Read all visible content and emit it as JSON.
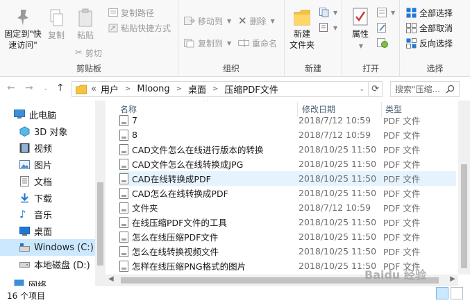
{
  "ribbon": {
    "clipboard": {
      "pin_label_line1": "固定到\"快",
      "pin_label_line2": "速访问\"",
      "copy_label": "复制",
      "paste_label": "粘贴",
      "cut_label": "剪切",
      "copy_path_label": "复制路径",
      "paste_shortcut_label": "粘贴快捷方式",
      "group_label": "剪贴板"
    },
    "organize": {
      "move_to_label": "移动到",
      "copy_to_label": "复制到",
      "delete_label": "删除",
      "rename_label": "重命名",
      "group_label": "组织"
    },
    "new": {
      "new_folder_line1": "新建",
      "new_folder_line2": "文件夹",
      "group_label": "新建"
    },
    "open": {
      "properties_label": "属性",
      "group_label": "打开"
    },
    "select": {
      "select_all_label": "全部选择",
      "select_none_label": "全部取消",
      "invert_label": "反向选择",
      "group_label": "选择"
    }
  },
  "address": {
    "overflow": "«",
    "crumbs": [
      "用户",
      "Mloong",
      "桌面",
      "压缩PDF文件"
    ],
    "search_placeholder": "搜索\"压缩..."
  },
  "navpane": {
    "items": [
      {
        "label": "此电脑",
        "icon": "computer-icon"
      },
      {
        "label": "3D 对象",
        "icon": "3d-objects-icon"
      },
      {
        "label": "视频",
        "icon": "video-icon"
      },
      {
        "label": "图片",
        "icon": "pictures-icon"
      },
      {
        "label": "文档",
        "icon": "documents-icon"
      },
      {
        "label": "下载",
        "icon": "download-icon"
      },
      {
        "label": "音乐",
        "icon": "music-icon"
      },
      {
        "label": "桌面",
        "icon": "desktop-icon"
      },
      {
        "label": "Windows (C:)",
        "icon": "windows-drive-icon"
      },
      {
        "label": "本地磁盘 (D:)",
        "icon": "drive-icon"
      },
      {
        "label": "网络",
        "icon": "network-icon"
      }
    ]
  },
  "list": {
    "headers": {
      "name": "名称",
      "date": "修改日期",
      "type": "类型"
    },
    "rows": [
      {
        "name": "7",
        "date": "2018/7/12 10:59",
        "type": "PDF 文件"
      },
      {
        "name": "8",
        "date": "2018/7/12 10:59",
        "type": "PDF 文件"
      },
      {
        "name": "CAD文件怎么在线进行版本的转换",
        "date": "2018/10/25 11:50",
        "type": "PDF 文件"
      },
      {
        "name": "CAD文件怎么在线转换成JPG",
        "date": "2018/10/25 11:50",
        "type": "PDF 文件"
      },
      {
        "name": "CAD在线转换成PDF",
        "date": "2018/10/25 11:50",
        "type": "PDF 文件"
      },
      {
        "name": "CAD怎么在线转换成PDF",
        "date": "2018/10/25 11:50",
        "type": "PDF 文件"
      },
      {
        "name": "文件夹",
        "date": "2018/7/12 10:59",
        "type": "PDF 文件"
      },
      {
        "name": "在线压缩PDF文件的工具",
        "date": "2018/10/25 11:50",
        "type": "PDF 文件"
      },
      {
        "name": "怎么在线压缩PDF文件",
        "date": "2018/10/25 11:50",
        "type": "PDF 文件"
      },
      {
        "name": "怎么在线转换视频文件",
        "date": "2018/10/25 11:50",
        "type": "PDF 文件"
      },
      {
        "name": "怎样在线压缩PNG格式的图片",
        "date": "2018/10/25 11:50",
        "type": "PDF 文件"
      }
    ]
  },
  "status": {
    "item_count": "16 个项目"
  },
  "watermark": "Baidu 经验",
  "colors": {
    "selection": "#cce8ff",
    "hover": "#e5f3ff",
    "header_text": "#4c607a",
    "accent_blue": "#1e78d7",
    "folder_yellow": "#f5c242"
  }
}
